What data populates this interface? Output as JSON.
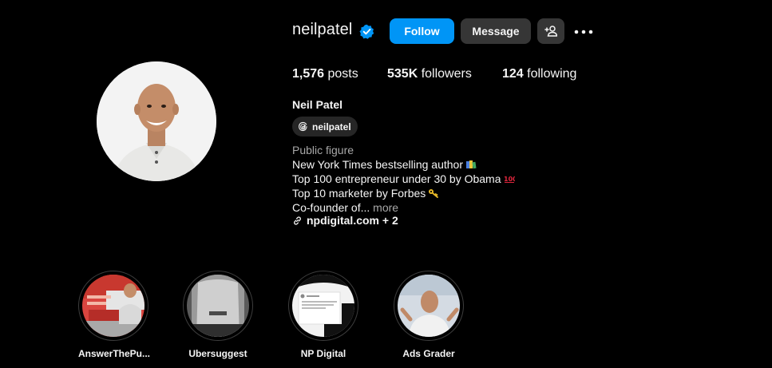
{
  "profile": {
    "username": "neilpatel",
    "verified_icon": "verified-badge-icon",
    "full_name": "Neil Patel",
    "threads_handle": "neilpatel",
    "category": "Public figure",
    "bio_lines": [
      "New York Times bestselling author",
      "Top 100 entrepreneur under 30 by Obama",
      "Top 10 marketer by Forbes",
      "Co-founder of..."
    ],
    "bio_more": "more",
    "link_text": "npdigital.com + 2"
  },
  "buttons": {
    "follow": "Follow",
    "message": "Message"
  },
  "stats": {
    "posts_count": "1,576",
    "posts_label": "posts",
    "followers_count": "535K",
    "followers_label": "followers",
    "following_count": "124",
    "following_label": "following"
  },
  "highlights": [
    {
      "label": "AnswerThePu..."
    },
    {
      "label": "Ubersuggest"
    },
    {
      "label": "NP Digital"
    },
    {
      "label": "Ads Grader"
    }
  ],
  "colors": {
    "background": "#000000",
    "follow_button": "#0095f6",
    "secondary_button": "#363636",
    "verified": "#0095f6",
    "muted_text": "#a8a8a8"
  }
}
